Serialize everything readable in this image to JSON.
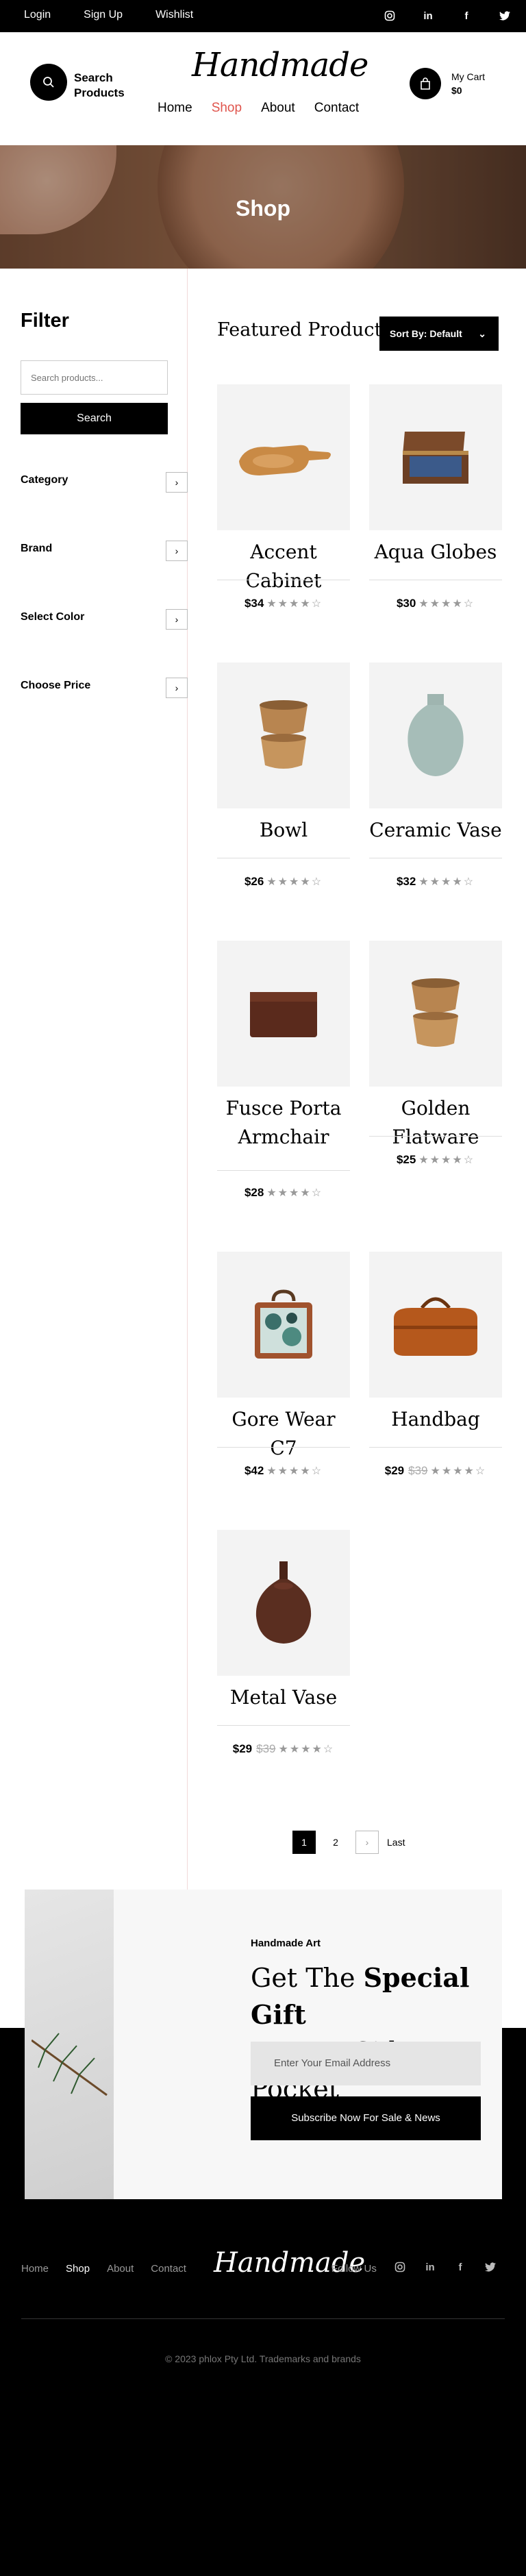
{
  "topbar": {
    "links": [
      "Login",
      "Sign Up",
      "Wishlist"
    ],
    "social_icons": [
      "instagram-icon",
      "linkedin-icon",
      "facebook-icon",
      "twitter-icon"
    ]
  },
  "header": {
    "search_label_1": "Search",
    "search_label_2": "Products",
    "logo": "Handmade",
    "nav": [
      "Home",
      "Shop",
      "About",
      "Contact"
    ],
    "active_nav": "Shop",
    "cart_label": "My Cart",
    "cart_total": "$0",
    "accent": "#e0554d"
  },
  "hero": {
    "title": "Shop"
  },
  "filter": {
    "title": "Filter",
    "search_placeholder": "Search products...",
    "search_button": "Search",
    "facets": [
      "Category",
      "Brand",
      "Select Color",
      "Choose Price"
    ]
  },
  "products_section": {
    "title": "Featured Products",
    "sort_label": "Sort By: Default"
  },
  "products": [
    {
      "name": "Accent Cabinet",
      "price": "$34",
      "old_price": "",
      "rating": 4
    },
    {
      "name": "Aqua Globes",
      "price": "$30",
      "old_price": "",
      "rating": 4
    },
    {
      "name": "Bowl",
      "price": "$26",
      "old_price": "",
      "rating": 4
    },
    {
      "name": "Ceramic Vase",
      "price": "$32",
      "old_price": "",
      "rating": 4
    },
    {
      "name": "Fusce Porta Armchair",
      "price": "$28",
      "old_price": "",
      "rating": 4
    },
    {
      "name": "Golden Flatware",
      "price": "$25",
      "old_price": "",
      "rating": 4
    },
    {
      "name": "Gore Wear C7",
      "price": "$42",
      "old_price": "",
      "rating": 4
    },
    {
      "name": "Handbag",
      "price": "$29",
      "old_price": "$39",
      "rating": 4
    },
    {
      "name": "Metal Vase",
      "price": "$29",
      "old_price": "$39",
      "rating": 4
    }
  ],
  "pagination": {
    "pages": [
      "1",
      "2"
    ],
    "next": "›",
    "last": "Last"
  },
  "promo": {
    "kicker": "Handmade Art",
    "heading_1": "Get The",
    "heading_bold": "Special Gift",
    "heading_2": "In Your Side Pocket",
    "email_placeholder": "Enter Your Email Address",
    "subscribe": "Subscribe Now For Sale & News"
  },
  "footer": {
    "nav": [
      "Home",
      "Shop",
      "About",
      "Contact"
    ],
    "logo": "Handmade",
    "follow": "Follow Us",
    "copyright": "© 2023 phlox Pty Ltd. Trademarks and brands"
  }
}
